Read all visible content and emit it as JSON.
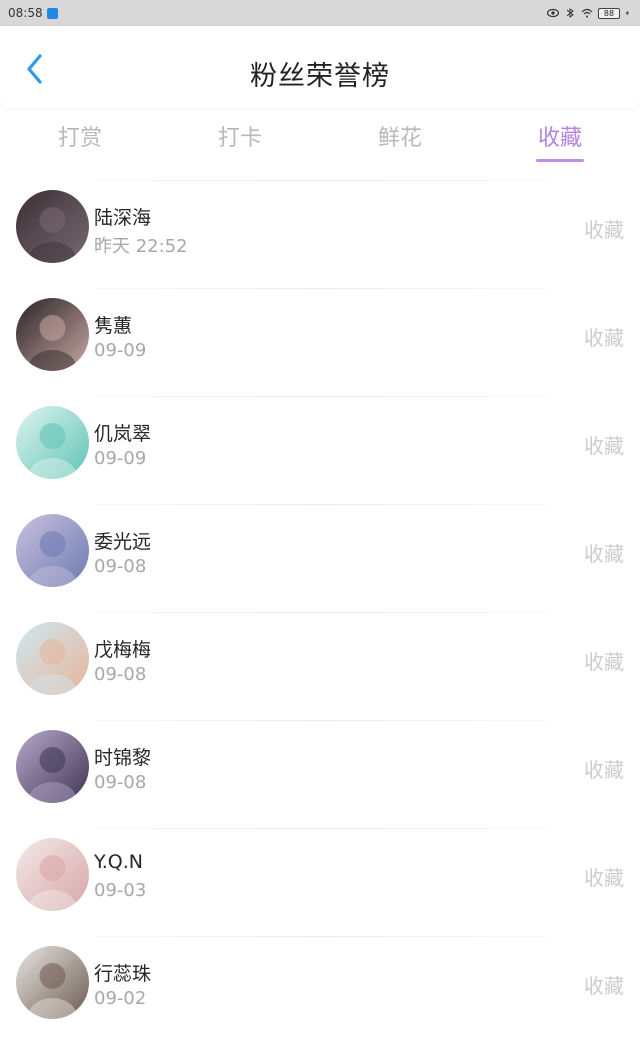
{
  "status_bar": {
    "time": "08:58",
    "battery": "88"
  },
  "header": {
    "title": "粉丝荣誉榜"
  },
  "tabs": [
    {
      "label": "打赏",
      "active": false
    },
    {
      "label": "打卡",
      "active": false
    },
    {
      "label": "鲜花",
      "active": false
    },
    {
      "label": "收藏",
      "active": true
    }
  ],
  "fans": [
    {
      "name": "陆深海",
      "date": "昨天 22:52",
      "action": "收藏",
      "avatar_colors": [
        "#3a2f35",
        "#7a6a72"
      ]
    },
    {
      "name": "隽蕙",
      "date": "09-09",
      "action": "收藏",
      "avatar_colors": [
        "#2a2226",
        "#c9a9a4"
      ]
    },
    {
      "name": "仉岚翠",
      "date": "09-09",
      "action": "收藏",
      "avatar_colors": [
        "#dff4ee",
        "#5ec3b5"
      ]
    },
    {
      "name": "委光远",
      "date": "09-08",
      "action": "收藏",
      "avatar_colors": [
        "#c9c1de",
        "#6c7ab0"
      ]
    },
    {
      "name": "戊梅梅",
      "date": "09-08",
      "action": "收藏",
      "avatar_colors": [
        "#cfe8f3",
        "#e7b49a"
      ]
    },
    {
      "name": "时锦黎",
      "date": "09-08",
      "action": "收藏",
      "avatar_colors": [
        "#b9a9cc",
        "#3d3552"
      ]
    },
    {
      "name": "Y.Q.N",
      "date": "09-03",
      "action": "收藏",
      "avatar_colors": [
        "#f3eaea",
        "#d7a5a5"
      ]
    },
    {
      "name": "行蕊珠",
      "date": "09-02",
      "action": "收藏",
      "avatar_colors": [
        "#e9e6e3",
        "#6b5a4e"
      ]
    }
  ],
  "colors": {
    "accent": "#b583e0",
    "back_arrow": "#2e9bea",
    "inactive_tab": "#b9b9b9"
  }
}
